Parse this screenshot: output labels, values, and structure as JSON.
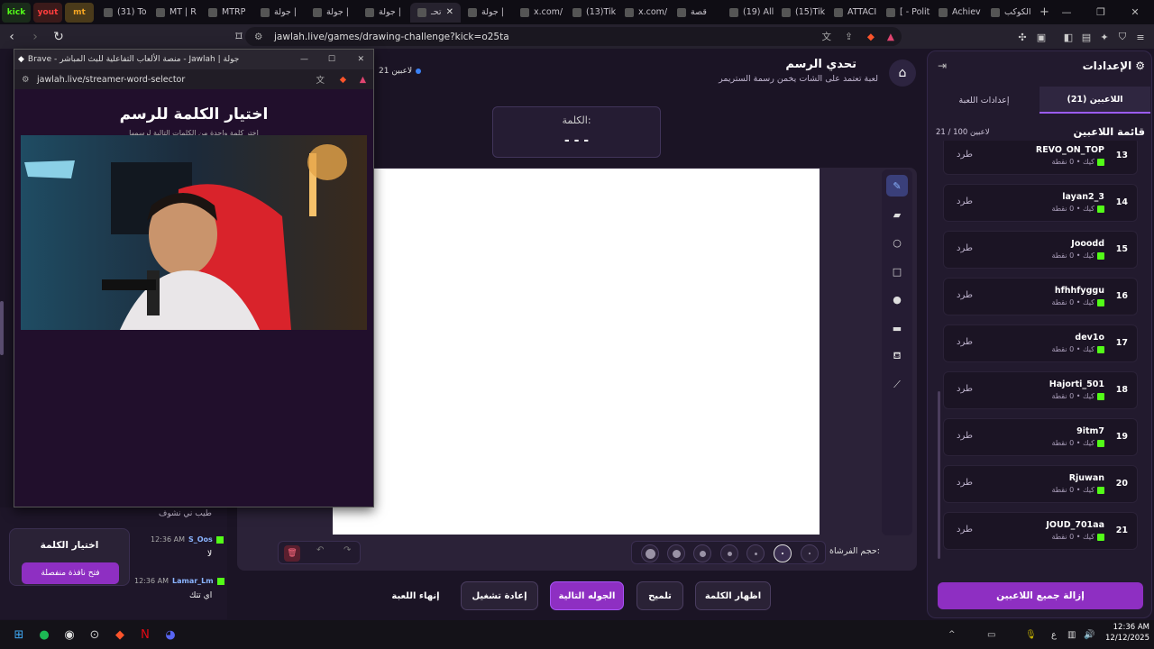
{
  "browser": {
    "pinned_tabs": [
      {
        "label": "kick",
        "color": "#53fc18"
      },
      {
        "label": "yout",
        "color": "#ff3d3d"
      },
      {
        "label": "mt",
        "color": "#f5a623"
      }
    ],
    "tabs": [
      {
        "label": "(31) To",
        "icon": "youtube-icon"
      },
      {
        "label": "MT | R",
        "icon": "mt-icon"
      },
      {
        "label": "MTRP",
        "icon": "mtrp-icon"
      },
      {
        "label": "جولة | ",
        "icon": "jawlah-icon"
      },
      {
        "label": "جولة | ",
        "icon": "jawlah-icon"
      },
      {
        "label": "جولة | ",
        "icon": "jawlah-icon"
      },
      {
        "label": "تحـ",
        "icon": "jawlah-icon",
        "active": true
      },
      {
        "label": "جولة | ",
        "icon": "jawlah-icon"
      },
      {
        "label": "x.com/",
        "icon": "x-icon"
      },
      {
        "label": "(13)Tik",
        "icon": "tiktok-icon"
      },
      {
        "label": "x.com/",
        "icon": "x-icon"
      },
      {
        "label": "قصة ",
        "icon": "story-icon"
      },
      {
        "label": "(19) All",
        "icon": "chat-icon"
      },
      {
        "label": "(15)Tik",
        "icon": "tiktok-icon"
      },
      {
        "label": "ATTACI",
        "icon": "attack-icon"
      },
      {
        "label": "[ - Polit",
        "icon": "purple-icon"
      },
      {
        "label": "Achiev",
        "icon": "kick-icon"
      },
      {
        "label": "الكوكب",
        "icon": "google-icon"
      }
    ],
    "url": "jawlah.live/games/drawing-challenge?kick=o25ta"
  },
  "game": {
    "players_online": "21 لاعبين",
    "title": "تحدي الرسم",
    "subtitle": "لعبة تعتمد على الشات يخمن رسمة الستريمر",
    "word_label": "الكلمة:",
    "word_mask": "- - -",
    "brush_label": "حجم الفرشاة:",
    "buttons": {
      "show_word": "اظهار الكلمة",
      "hint": "تلميح",
      "next_round": "الجوله التالية",
      "restart": "إعادة تشغيل",
      "end_game": "إنهاء اللعبة"
    }
  },
  "settings": {
    "title": "الإعدادات",
    "tab_players": "اللاعبين (21)",
    "tab_game": "إعدادات اللعبة",
    "list_title": "قائمة اللاعبين",
    "count": "21 / 100 لاعبين",
    "kick_label": "طرد",
    "remove_all": "إزالة جميع اللاعبين",
    "meta": "كيك • 0 نقطة",
    "players": [
      {
        "num": "13",
        "name": "REVO_ON_TOP"
      },
      {
        "num": "14",
        "name": "layan2_3"
      },
      {
        "num": "15",
        "name": "Jooodd"
      },
      {
        "num": "16",
        "name": "hfhhfyggu"
      },
      {
        "num": "17",
        "name": "dev1o"
      },
      {
        "num": "18",
        "name": "Hajorti_501"
      },
      {
        "num": "19",
        "name": "9itm7"
      },
      {
        "num": "20",
        "name": "Rjuwan"
      },
      {
        "num": "21",
        "name": "JOUD_701aa"
      }
    ]
  },
  "popup": {
    "title": "Brave - منصة الألعاب التفاعلية للبث المباشر - Jawlah | جولة",
    "url": "jawlah.live/streamer-word-selector",
    "heading": "اختيار الكلمة للرسم",
    "subheading": "اختر كلمة واحدة من الكلمات التالية لرسمها"
  },
  "chat": {
    "partial_message": "طيب ني نشوف",
    "choose_title": "اختيار الكلمة",
    "open_window": "فتح نافذة منفصلة",
    "messages": [
      {
        "user": "S_Oos",
        "time": "12:36 AM",
        "text": "لا"
      },
      {
        "user": "Lamar_Lm",
        "time": "12:36 AM",
        "text": "اي تتك"
      }
    ]
  },
  "taskbar": {
    "time": "12:36 AM",
    "date": "12/12/2025",
    "lang": "ع"
  }
}
